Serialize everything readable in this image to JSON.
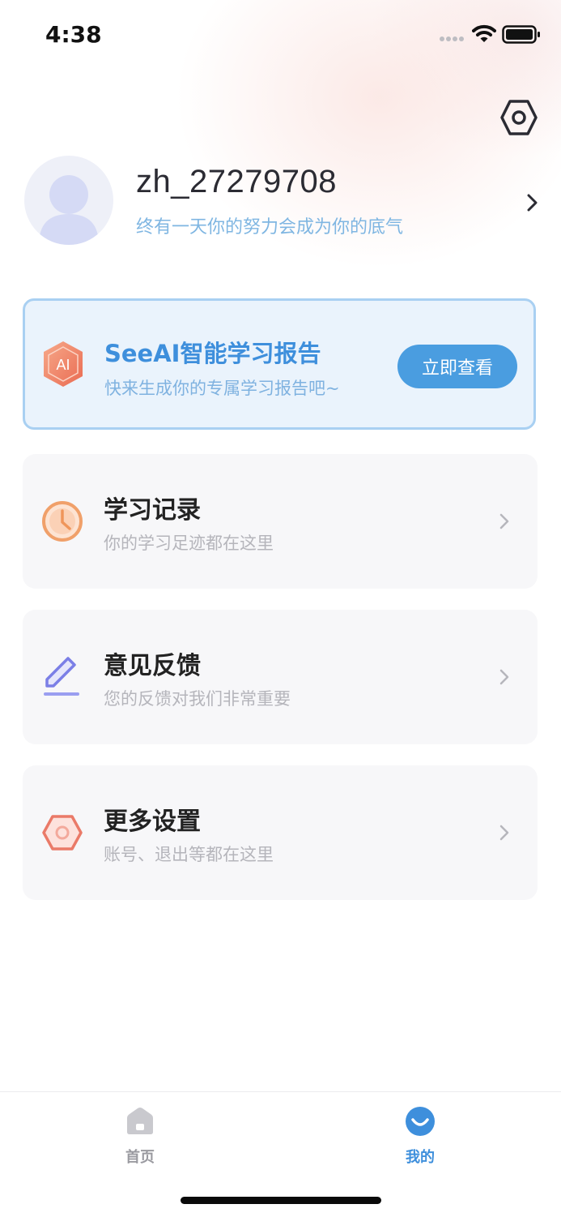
{
  "status_bar": {
    "time": "4:38"
  },
  "profile": {
    "username": "zh_27279708",
    "motto": "终有一天你的努力会成为你的底气"
  },
  "ai_report": {
    "badge_text": "AI",
    "title": "SeeAI智能学习报告",
    "subtitle": "快来生成你的专属学习报告吧~",
    "button_label": "立即查看"
  },
  "menu": [
    {
      "title": "学习记录",
      "subtitle": "你的学习足迹都在这里",
      "icon": "clock-icon"
    },
    {
      "title": "意见反馈",
      "subtitle": "您的反馈对我们非常重要",
      "icon": "pencil-icon"
    },
    {
      "title": "更多设置",
      "subtitle": "账号、退出等都在这里",
      "icon": "hexagon-settings-icon"
    }
  ],
  "tabs": [
    {
      "label": "首页",
      "icon": "home-icon",
      "active": false
    },
    {
      "label": "我的",
      "icon": "smile-icon",
      "active": true
    }
  ],
  "colors": {
    "accent": "#4a9de0",
    "ai_title": "#3e8fdc",
    "tab_inactive": "#9a9aa0",
    "tab_active": "#3e8fdc"
  }
}
